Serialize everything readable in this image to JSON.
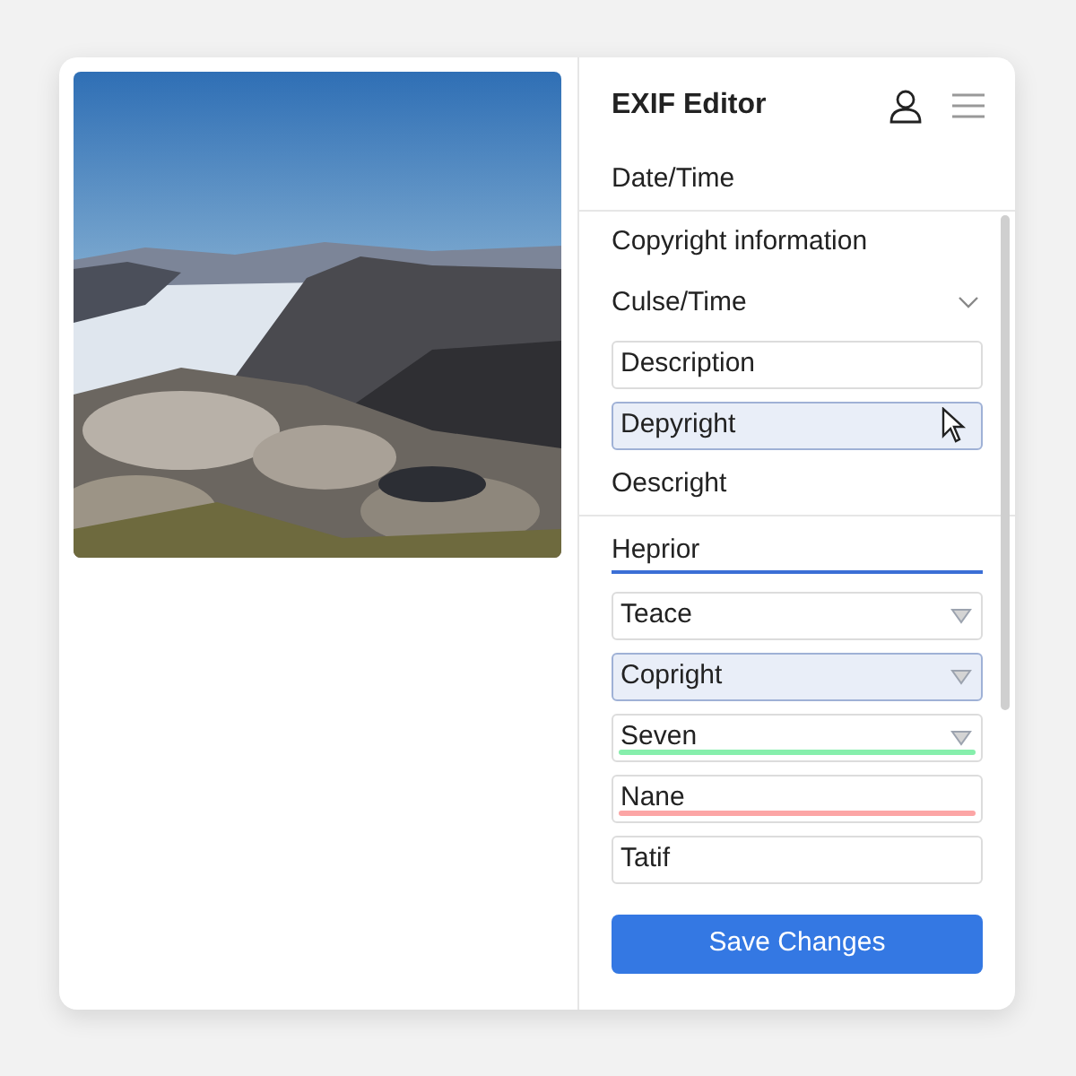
{
  "panel": {
    "title": "EXIF Editor"
  },
  "items": [
    {
      "kind": "label",
      "text": "Date/Time",
      "divider": true,
      "selected": false
    },
    {
      "kind": "label",
      "text": "Copyright information",
      "divider": false,
      "selected": false
    },
    {
      "kind": "expander",
      "text": "Culse/Time",
      "divider": false,
      "selected": false
    },
    {
      "kind": "field",
      "text": "Description",
      "selected": false
    },
    {
      "kind": "field",
      "text": "Depyright",
      "selected": true,
      "cursor": true
    },
    {
      "kind": "label",
      "text": "Oescright",
      "divider": true,
      "selected": false
    },
    {
      "kind": "underline",
      "text": "Heprior",
      "selected": false
    },
    {
      "kind": "select",
      "text": "Teace",
      "selected": false
    },
    {
      "kind": "select",
      "text": "Copright",
      "selected": true
    },
    {
      "kind": "select",
      "text": "Seven",
      "selected": false,
      "color": "#86efac"
    },
    {
      "kind": "field",
      "text": "Nane",
      "selected": false,
      "color": "#fca5a5"
    },
    {
      "kind": "field",
      "text": "Tatif",
      "selected": false
    }
  ],
  "save_button": "Save Changes"
}
